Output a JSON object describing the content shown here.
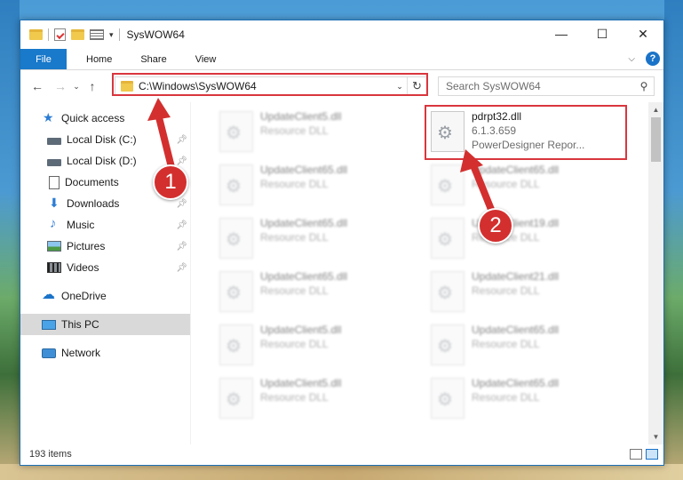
{
  "window": {
    "title": "SysWOW64",
    "controls": {
      "minimize": "—",
      "maximize": "☐",
      "close": "✕"
    }
  },
  "ribbon": {
    "file": "File",
    "tabs": [
      "Home",
      "Share",
      "View"
    ],
    "help": "?"
  },
  "address": {
    "path": "C:\\Windows\\SysWOW64",
    "search_placeholder": "Search SysWOW64"
  },
  "sidebar": {
    "items": [
      {
        "label": "Quick access",
        "icon": "star-icon"
      },
      {
        "label": "Local Disk (C:)",
        "icon": "disk-icon",
        "pinned": true
      },
      {
        "label": "Local Disk (D:)",
        "icon": "disk-icon",
        "pinned": true
      },
      {
        "label": "Documents",
        "icon": "documents-icon",
        "pinned": true
      },
      {
        "label": "Downloads",
        "icon": "downloads-icon",
        "pinned": true
      },
      {
        "label": "Music",
        "icon": "music-icon",
        "pinned": true
      },
      {
        "label": "Pictures",
        "icon": "pictures-icon",
        "pinned": true
      },
      {
        "label": "Videos",
        "icon": "videos-icon",
        "pinned": true
      },
      {
        "label": "OneDrive",
        "icon": "onedrive-icon"
      },
      {
        "label": "This PC",
        "icon": "this-pc-icon",
        "selected": true
      },
      {
        "label": "Network",
        "icon": "network-icon"
      }
    ]
  },
  "files": {
    "highlighted": {
      "name": "pdrpt32.dll",
      "version": "6.1.3.659",
      "desc": "PowerDesigner Repor..."
    },
    "left_column": [
      {
        "name": "UpdateClient5.dll",
        "desc": "Resource DLL"
      },
      {
        "name": "UpdateClient65.dll",
        "desc": "Resource DLL"
      },
      {
        "name": "UpdateClient65.dll",
        "desc": "Resource DLL"
      },
      {
        "name": "UpdateClient65.dll",
        "desc": "Resource DLL"
      },
      {
        "name": "UpdateClient5.dll",
        "desc": "Resource DLL"
      },
      {
        "name": "UpdateClient5.dll",
        "desc": "Resource DLL"
      }
    ],
    "right_column": [
      {
        "name": "UpdateClient65.dll",
        "desc": "Resource DLL"
      },
      {
        "name": "UpdateClient19.dll",
        "desc": "Resource DLL"
      },
      {
        "name": "UpdateClient21.dll",
        "desc": "Resource DLL"
      },
      {
        "name": "UpdateClient65.dll",
        "desc": "Resource DLL"
      },
      {
        "name": "UpdateClient65.dll",
        "desc": "Resource DLL"
      }
    ]
  },
  "status": {
    "count": "193 items"
  },
  "annotations": {
    "step1": "1",
    "step2": "2",
    "color": "#d32f2f"
  }
}
